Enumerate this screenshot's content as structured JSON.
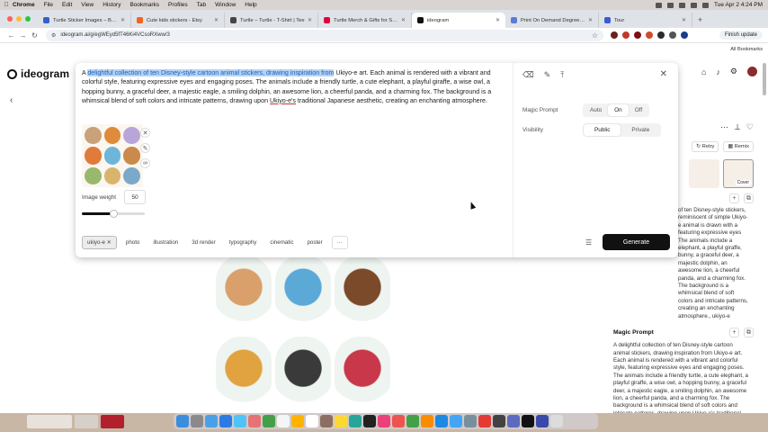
{
  "menubar": {
    "app": "Chrome",
    "items": [
      "File",
      "Edit",
      "View",
      "History",
      "Bookmarks",
      "Profiles",
      "Tab",
      "Window",
      "Help"
    ],
    "clock": "Tue Apr 2  4:24 PM"
  },
  "browser": {
    "tabs": [
      {
        "label": "Turtle Sticker Images – Brow",
        "color": "#2f62c9"
      },
      {
        "label": "Cute kids stickers - Etsy",
        "color": "#f1641e"
      },
      {
        "label": "Turtle – Turtle - T-Shirt | Tee",
        "color": "#444444"
      },
      {
        "label": "Turtle Merch & Gifts for Sale",
        "color": "#e4003a"
      },
      {
        "label": "ideogram",
        "color": "#111111"
      },
      {
        "label": "Print On Demand Degree (P...",
        "color": "#5a7bd8"
      },
      {
        "label": "Tour",
        "color": "#3b5bd6"
      }
    ],
    "url": "ideogram.ai/g/egWEyd5fT46Ki4VCsoRXww/3",
    "finish_update": "Finish update",
    "all_bookmarks": "All Bookmarks"
  },
  "site": {
    "logo": "ideogram"
  },
  "editor": {
    "prompt_pre": "A ",
    "prompt_highlight": "delightful collection of ten Disney-style cartoon animal stickers, drawing inspiration from",
    "prompt_mid": " Ukiyo-e art. Each animal is rendered with a vibrant and colorful style, featuring expressive eyes and engaging poses. The animals include a friendly turtle, a cute elephant, a playful giraffe, a wise owl, a hopping bunny, a graceful deer, a majestic eagle, a smiling dolphin, an awesome lion, a cheerful panda, and a charming fox. The background is a whimsical blend of soft colors and intricate patterns, drawing upon ",
    "prompt_underlined": "Ukiyo-e's",
    "prompt_post": " traditional Japanese aesthetic, creating an enchanting atmosphere.",
    "image_weight_label": "Image weight",
    "image_weight_value": "50",
    "image_weight": 0.5,
    "chips": [
      "ukiyo-e",
      "photo",
      "illustration",
      "3d render",
      "typography",
      "cinematic",
      "poster",
      "···"
    ],
    "magic_prompt_label": "Magic Prompt",
    "magic_prompt_options": [
      "Auto",
      "On",
      "Off"
    ],
    "magic_prompt_selected": "On",
    "visibility_label": "Visibility",
    "visibility_options": [
      "Public",
      "Private"
    ],
    "visibility_selected": "Public",
    "generate_label": "Generate"
  },
  "right_panel": {
    "retry": "Retry",
    "remix": "Remix",
    "cover": "Cover",
    "prompt_text": "of ten Disney-style stickers, reminiscent of simple Ukiyo-e animal is drawn with a featuring expressive eyes The animals include a elephant, a playful giraffe, bunny, a graceful deer, a majestic dolphin, an awesome lion, a cheerful panda, and a charming fox. The background is a whimsical blend of soft colors and intricate patterns, creating an enchanting atmosphere., ukiyo-e",
    "magic_prompt_heading": "Magic Prompt",
    "magic_prompt_text": "A delightful collection of ten Disney-style cartoon animal stickers, drawing inspiration from Ukiyo-e art. Each animal is rendered with a vibrant and colorful style, featuring expressive eyes and engaging poses. The animals include a friendly turtle, a cute elephant, a playful giraffe, a wise owl, a hopping bunny, a graceful deer, a majestic eagle, a smiling dolphin, an awesome lion, a cheerful panda, and a charming fox. The background is a whimsical blend of soft colors and intricate patterns, drawing upon Ukiyo-e's traditional Japanese"
  },
  "gallery": {
    "stickers": [
      {
        "icon": "deer-sticker",
        "color": "#d9a06b"
      },
      {
        "icon": "dolphin-sticker",
        "color": "#5aa9d6"
      },
      {
        "icon": "eagle-sticker",
        "color": "#7a4a2a"
      },
      {
        "icon": "lion-sticker",
        "color": "#e0a340"
      },
      {
        "icon": "panda-sticker",
        "color": "#3a3a3a"
      },
      {
        "icon": "red-panda-sticker",
        "color": "#c9384a"
      }
    ]
  },
  "colors": {
    "highlight": "#b5d3f7",
    "generate_bg": "#111111",
    "menubar_bg": "#d9d4d2"
  }
}
